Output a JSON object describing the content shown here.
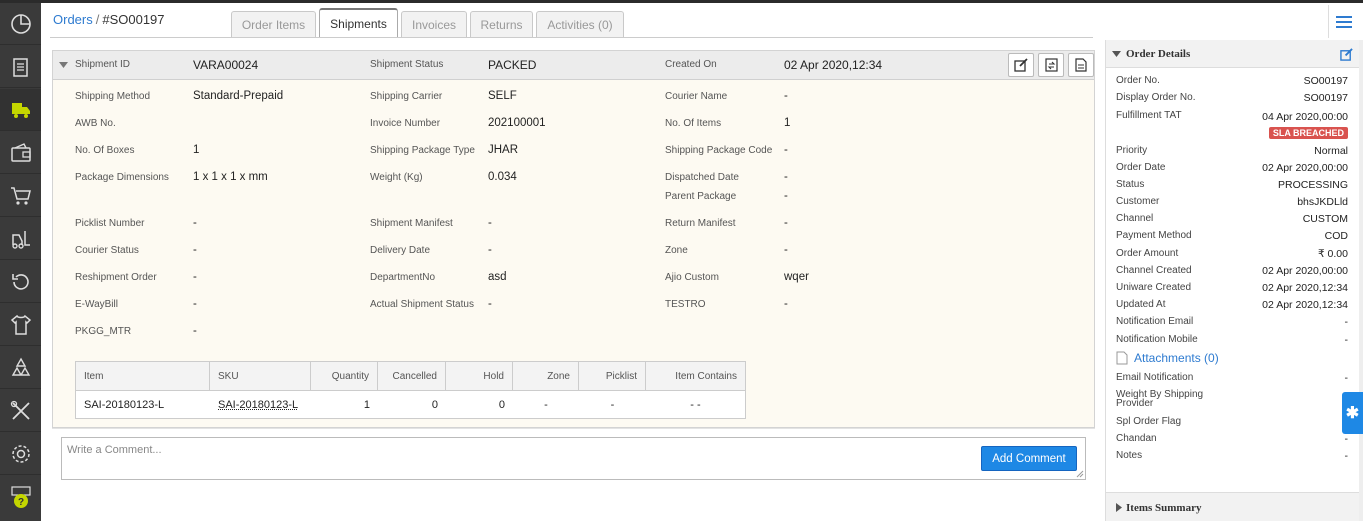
{
  "breadcrumb": {
    "root": "Orders",
    "separator": "/",
    "current": "#SO00197"
  },
  "tabs": [
    {
      "label": "Order Items"
    },
    {
      "label": "Shipments"
    },
    {
      "label": "Invoices"
    },
    {
      "label": "Returns"
    },
    {
      "label": "Activities (0)"
    }
  ],
  "shipment": {
    "header": {
      "shipment_id_label": "Shipment ID",
      "shipment_id": "VARA00024",
      "status_label": "Shipment Status",
      "status": "PACKED",
      "created_label": "Created On",
      "created": "02 Apr 2020,12:34"
    },
    "fields": [
      {
        "label": "Shipping Method",
        "value": "Standard-Prepaid"
      },
      {
        "label": "Shipping Carrier",
        "value": "SELF"
      },
      {
        "label": "Courier Name",
        "value": "-"
      },
      {
        "label": "AWB No.",
        "value": ""
      },
      {
        "label": "Invoice Number",
        "value": "202100001"
      },
      {
        "label": "No. Of Items",
        "value": "1"
      },
      {
        "label": "No. Of Boxes",
        "value": "1"
      },
      {
        "label": "Shipping Package Type",
        "value": "JHAR"
      },
      {
        "label": "Shipping Package Code",
        "value": "-"
      },
      {
        "label": "Package Dimensions",
        "value": "1 x 1 x 1 x mm"
      },
      {
        "label": "Weight (Kg)",
        "value": "0.034"
      },
      {
        "label": "Dispatched Date",
        "value": "-"
      },
      {
        "label": "Parent Package",
        "value": "-"
      },
      {
        "label": "Picklist Number",
        "value": "-"
      },
      {
        "label": "Shipment Manifest",
        "value": "-"
      },
      {
        "label": "Return Manifest",
        "value": "-"
      },
      {
        "label": "Courier Status",
        "value": "-"
      },
      {
        "label": "Delivery Date",
        "value": "-"
      },
      {
        "label": "Zone",
        "value": "-"
      },
      {
        "label": "Reshipment Order",
        "value": "-"
      },
      {
        "label": "DepartmentNo",
        "value": "asd"
      },
      {
        "label": "Ajio Custom",
        "value": "wqer"
      },
      {
        "label": "E-WayBill",
        "value": "-"
      },
      {
        "label": "Actual Shipment Status",
        "value": "-"
      },
      {
        "label": "TESTRO",
        "value": "-"
      },
      {
        "label": "PKGG_MTR",
        "value": "-"
      }
    ],
    "table": {
      "headers": [
        "Item",
        "SKU",
        "Quantity",
        "Cancelled",
        "Hold",
        "Zone",
        "Picklist",
        "Item Contains"
      ],
      "rows": [
        [
          "SAI-20180123-L",
          "SAI-20180123-L",
          "1",
          "0",
          "0",
          "-",
          "-",
          "- -"
        ]
      ]
    }
  },
  "comment": {
    "placeholder": "Write a Comment...",
    "add_label": "Add Comment"
  },
  "order_details": {
    "title": "Order Details",
    "fields": [
      {
        "label": "Order No.",
        "value": "SO00197"
      },
      {
        "label": "Display Order No.",
        "value": "SO00197"
      },
      {
        "label": "Fulfillment TAT",
        "value": "04 Apr 2020,00:00"
      },
      {
        "label": "Priority",
        "value": "Normal"
      },
      {
        "label": "Order Date",
        "value": "02 Apr 2020,00:00"
      },
      {
        "label": "Status",
        "value": "PROCESSING"
      },
      {
        "label": "Customer",
        "value": "bhsJKDLld"
      },
      {
        "label": "Channel",
        "value": "CUSTOM"
      },
      {
        "label": "Payment Method",
        "value": "COD"
      },
      {
        "label": "Order Amount",
        "value": "₹ 0.00"
      },
      {
        "label": "Channel Created",
        "value": "02 Apr 2020,00:00"
      },
      {
        "label": "Uniware Created",
        "value": "02 Apr 2020,12:34"
      },
      {
        "label": "Updated At",
        "value": "02 Apr 2020,12:34"
      },
      {
        "label": "Notification Email",
        "value": "-"
      },
      {
        "label": "Notification Mobile",
        "value": "-"
      },
      {
        "label": "Email Notification",
        "value": "-"
      },
      {
        "label": "Weight By Shipping Provider",
        "value": "-"
      },
      {
        "label": "Spl Order Flag",
        "value": "-"
      },
      {
        "label": "Chandan",
        "value": "-"
      },
      {
        "label": "Notes",
        "value": "-"
      }
    ],
    "sla_badge": "SLA BREACHED",
    "attachments": "Attachments (0)"
  },
  "items_summary": {
    "title": "Items Summary"
  },
  "colors": {
    "accent": "#2e7bd0",
    "button": "#1e88e5",
    "badge": "#d9534f",
    "sidebar": "#3a3a3a",
    "sidebar_active_icon": "#c4d600"
  }
}
